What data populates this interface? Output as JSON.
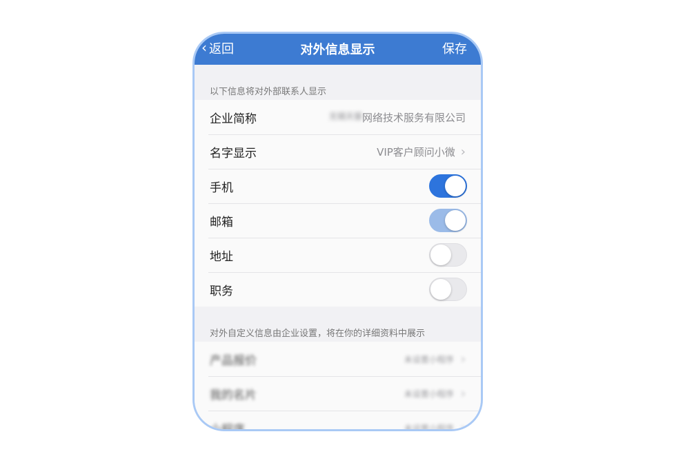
{
  "nav": {
    "back_label": "返回",
    "title": "对外信息显示",
    "save_label": "保存"
  },
  "section1": {
    "label": "以下信息将对外部联系人显示",
    "company": {
      "label": "企业简称",
      "value_blurred": "无锡天督",
      "value_visible": "网络技术服务有限公司"
    },
    "name_display": {
      "label": "名字显示",
      "value": "VIP客户顾问小微"
    },
    "toggles": [
      {
        "label": "手机",
        "state": "on"
      },
      {
        "label": "邮箱",
        "state": "on-disabled"
      },
      {
        "label": "地址",
        "state": "off"
      },
      {
        "label": "职务",
        "state": "off"
      }
    ]
  },
  "section2": {
    "label": "对外自定义信息由企业设置，将在你的详细资料中展示",
    "items": [
      {
        "label": "产品报价",
        "value": "未设置小程序"
      },
      {
        "label": "我的名片",
        "value": "未设置小程序"
      },
      {
        "label": "小程序",
        "value": "未设置小程序"
      }
    ]
  },
  "colors": {
    "nav_bg": "#3d7bd2",
    "toggle_on": "#2d74dd",
    "toggle_on_disabled": "#9bbbe8",
    "frame_border": "#a9c9f5"
  }
}
